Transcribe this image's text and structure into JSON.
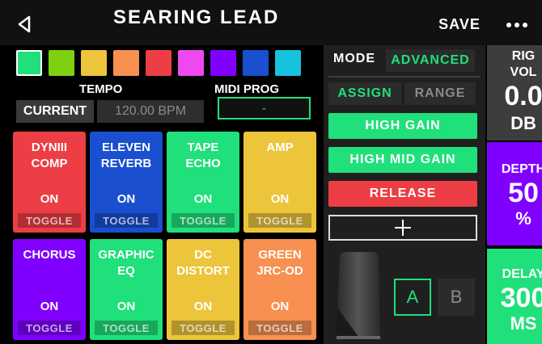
{
  "header": {
    "back_icon": "back-arrow-icon",
    "title": "SEARING LEAD",
    "save_label": "SAVE",
    "more_icon": "ellipsis-icon"
  },
  "swatches": [
    {
      "color": "#1fe07a",
      "selected": true
    },
    {
      "color": "#7ed10f"
    },
    {
      "color": "#ecc53b"
    },
    {
      "color": "#f79050"
    },
    {
      "color": "#ec3e44"
    },
    {
      "color": "#f048f0"
    },
    {
      "color": "#8000ff"
    },
    {
      "color": "#1a4fd0"
    },
    {
      "color": "#15c3dc"
    }
  ],
  "tempo": {
    "title": "TEMPO",
    "current_label": "CURRENT",
    "bpm": "120.00 BPM"
  },
  "midi": {
    "title": "MIDI PROG",
    "value": "-"
  },
  "fx_blocks": [
    {
      "name": "DYNIII\nCOMP",
      "state": "ON",
      "toggle": "TOGGLE",
      "color": "#ec3e44"
    },
    {
      "name": "ELEVEN\nREVERB",
      "state": "ON",
      "toggle": "TOGGLE",
      "color": "#1a4fd0"
    },
    {
      "name": "TAPE\nECHO",
      "state": "ON",
      "toggle": "TOGGLE",
      "color": "#1fe07a"
    },
    {
      "name": "AMP",
      "state": "ON",
      "toggle": "TOGGLE",
      "color": "#ecc53b"
    },
    {
      "name": "CHORUS",
      "state": "ON",
      "toggle": "TOGGLE",
      "color": "#8000ff"
    },
    {
      "name": "GRAPHIC\nEQ",
      "state": "ON",
      "toggle": "TOGGLE",
      "color": "#1fe07a"
    },
    {
      "name": "DC\nDISTORT",
      "state": "ON",
      "toggle": "TOGGLE",
      "color": "#ecc53b"
    },
    {
      "name": "GREEN\nJRC-OD",
      "state": "ON",
      "toggle": "TOGGLE",
      "color": "#f79050"
    }
  ],
  "controller": {
    "mode_label": "MODE",
    "mode_value": "ADVANCED",
    "assign_label": "ASSIGN",
    "range_label": "RANGE",
    "params": [
      {
        "label": "HIGH GAIN",
        "color": "#1fe07a"
      },
      {
        "label": "HIGH MID GAIN",
        "color": "#1fe07a"
      },
      {
        "label": "RELEASE",
        "color": "#ec3e44"
      }
    ],
    "add_icon": "plus-icon",
    "pedal_icon": "expression-pedal-icon",
    "a_label": "A",
    "b_label": "B"
  },
  "knobs": [
    {
      "label": "RIG\nVOL",
      "value": "0.0",
      "unit": "DB",
      "color": "#3d3d3d"
    },
    {
      "label": "DEPTH",
      "value": "50",
      "unit": "%",
      "color": "#8000ff"
    },
    {
      "label": "DELAY",
      "value": "300",
      "unit": "MS",
      "color": "#1fe07a"
    }
  ]
}
